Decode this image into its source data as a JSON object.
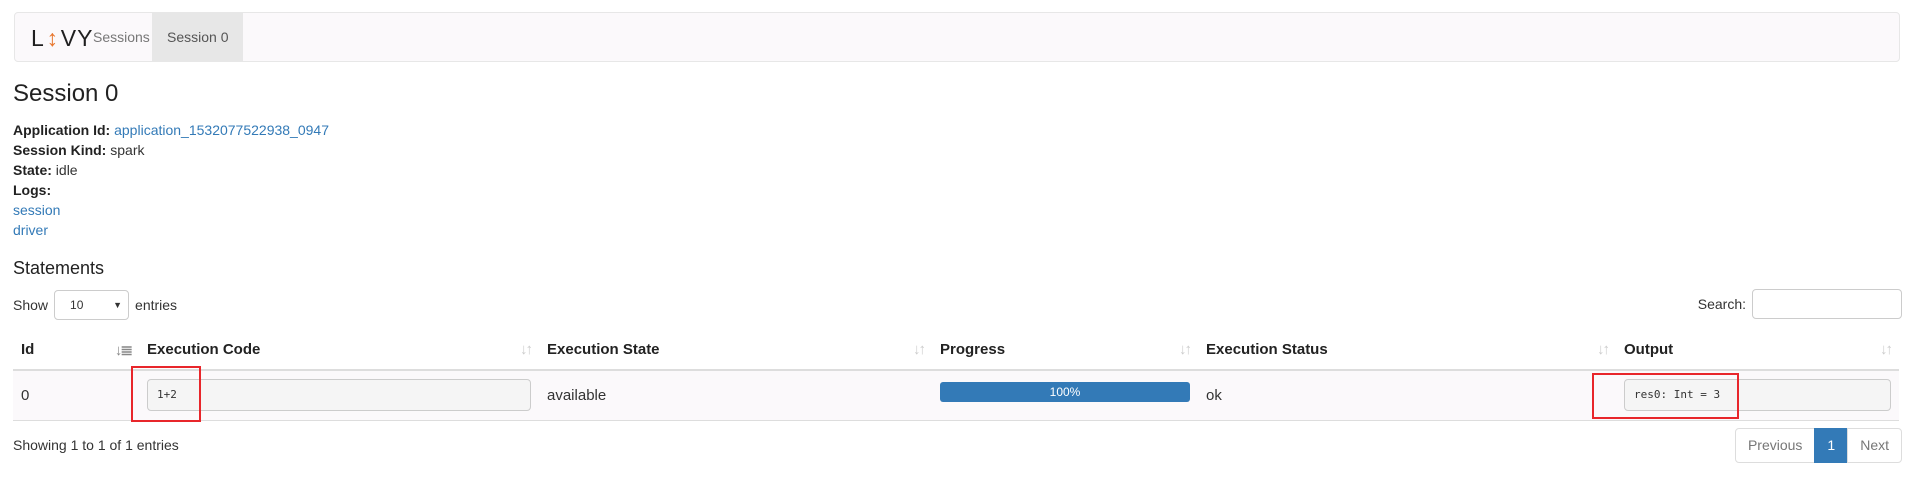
{
  "navbar": {
    "brand_left": "L",
    "brand_arrow": "↕",
    "brand_right": "VY",
    "items": [
      {
        "label": "Sessions"
      },
      {
        "label": "Session 0"
      }
    ]
  },
  "page_title": "Session 0",
  "info": {
    "application_id_label": "Application Id:",
    "application_id": "application_1532077522938_0947",
    "session_kind_label": "Session Kind:",
    "session_kind": "spark",
    "state_label": "State:",
    "state": "idle",
    "logs_label": "Logs:",
    "logs": [
      "session",
      "driver"
    ]
  },
  "statements": {
    "heading": "Statements",
    "show_label": "Show",
    "entries_value": "10",
    "entries_label": "entries",
    "search_label": "Search:",
    "columns": [
      "Id",
      "Execution Code",
      "Execution State",
      "Progress",
      "Execution Status",
      "Output"
    ],
    "rows": [
      {
        "id": "0",
        "code": "1+2",
        "state": "available",
        "progress_value": 1.0,
        "progress_label": "100%",
        "status": "ok",
        "output": "res0: Int = 3"
      }
    ],
    "footer": "Showing 1 to 1 of 1 entries",
    "pagination": {
      "previous": "Previous",
      "current": "1",
      "next": "Next"
    }
  },
  "colors": {
    "link": "#337ab7",
    "brand_accent": "#e8772e",
    "highlight": "#e8262b",
    "progress_bar": "#337ab7"
  }
}
